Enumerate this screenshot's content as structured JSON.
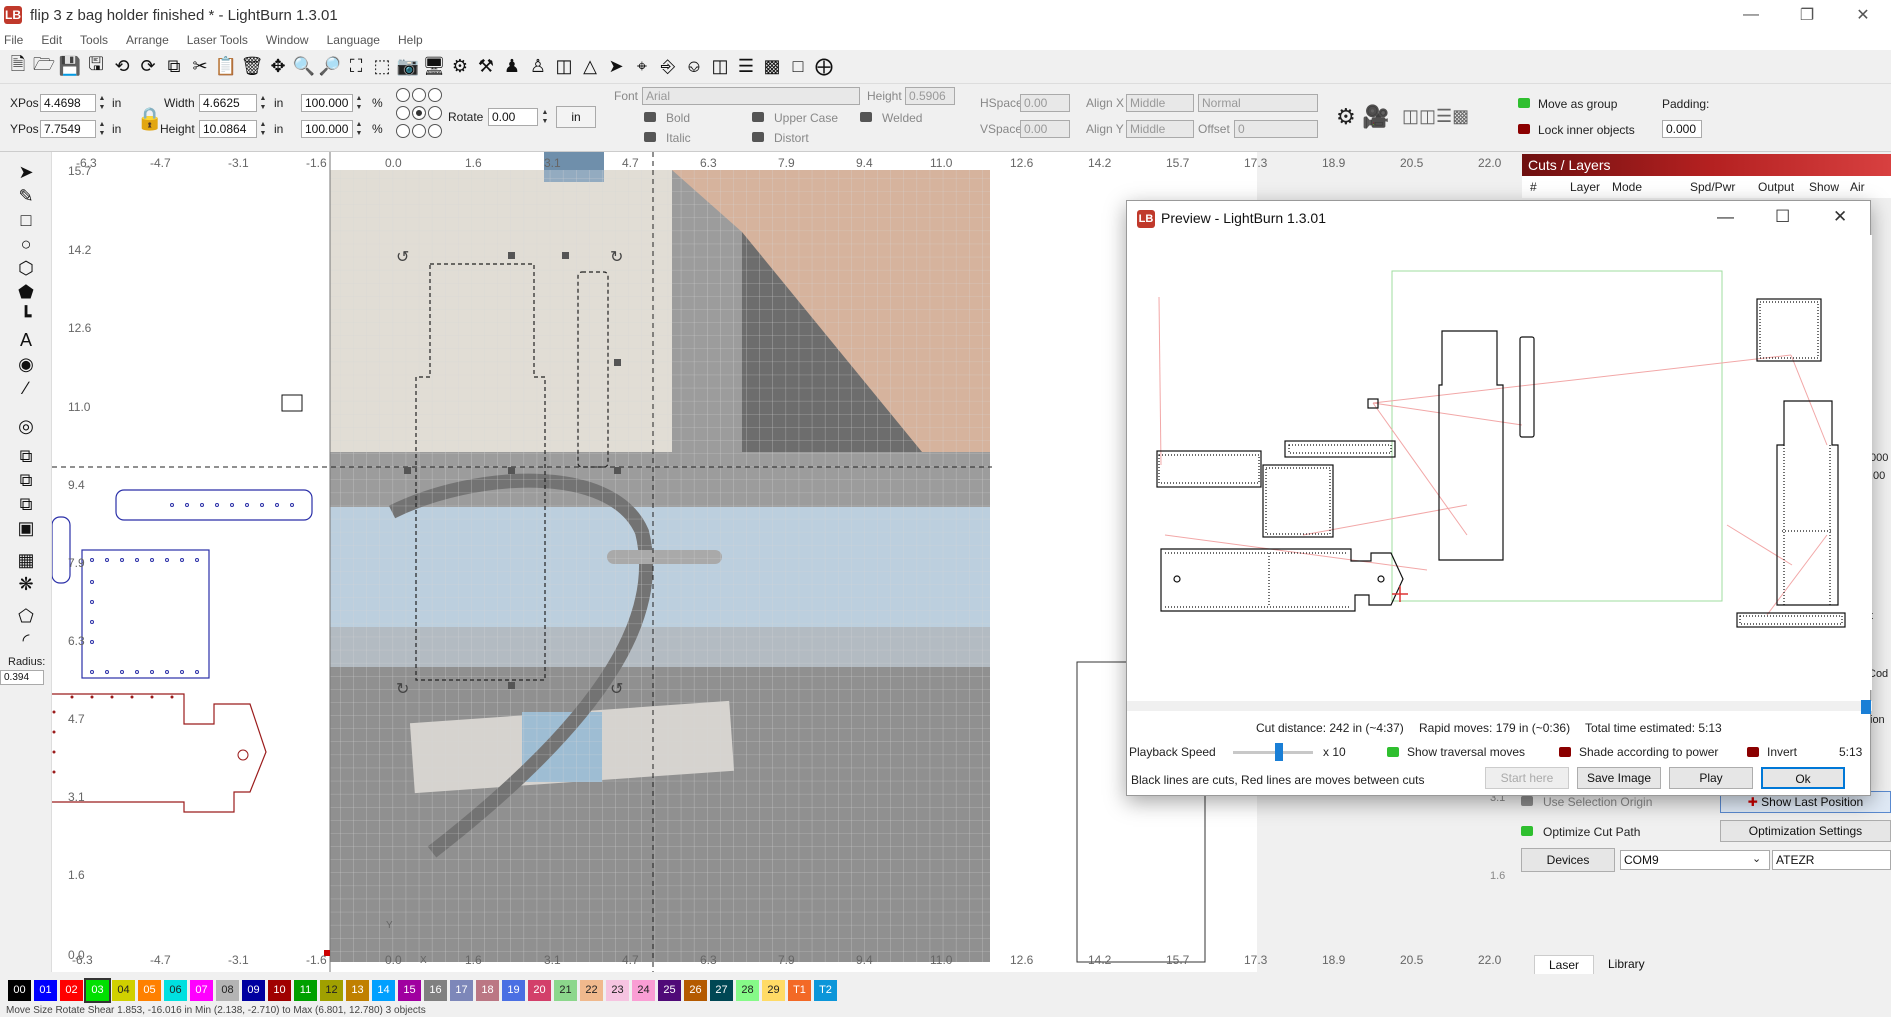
{
  "window": {
    "title": "flip 3 z bag holder finished * - LightBurn 1.3.01",
    "app_logo": "LB"
  },
  "menu": [
    "File",
    "Edit",
    "Tools",
    "Arrange",
    "Laser Tools",
    "Window",
    "Language",
    "Help"
  ],
  "props": {
    "xpos_label": "XPos",
    "xpos": "4.4698",
    "ypos_label": "YPos",
    "ypos": "7.7549",
    "unit": "in",
    "width_label": "Width",
    "width": "4.6625",
    "height_label": "Height",
    "height": "10.0864",
    "scale_w": "100.000",
    "scale_h": "100.000",
    "percent": "%",
    "rotate_label": "Rotate",
    "rotate": "0.00",
    "unit_btn": "in",
    "font_label": "Font",
    "font": "Arial",
    "fheight_label": "Height",
    "fheight": "0.5906",
    "hspace_label": "HSpace",
    "hspace": "0.00",
    "vspace_label": "VSpace",
    "vspace": "0.00",
    "alignx_label": "Align X",
    "alignx": "Middle",
    "aligny_label": "Align Y",
    "aligny": "Middle",
    "normal": "Normal",
    "offset_label": "Offset",
    "offset": "0",
    "bold": "Bold",
    "italic": "Italic",
    "upper": "Upper Case",
    "distort": "Distort",
    "welded": "Welded",
    "move_group": "Move as group",
    "lock_inner": "Lock inner objects",
    "padding_label": "Padding:",
    "padding": "0.000"
  },
  "left_tools": {
    "radius_label": "Radius:",
    "radius": "0.394"
  },
  "ruler": {
    "top": [
      "-6.3",
      "-4.7",
      "-3.1",
      "-1.6",
      "0.0",
      "1.6",
      "3.1",
      "4.7",
      "6.3",
      "7.9",
      "9.4",
      "11.0",
      "12.6",
      "14.2",
      "15.7",
      "17.3",
      "18.9",
      "20.5",
      "22.0"
    ],
    "left": [
      "15.7",
      "14.2",
      "12.6",
      "11.0",
      "9.4",
      "7.9",
      "6.3",
      "4.7",
      "3.1",
      "1.6",
      "0.0"
    ],
    "bottom": [
      "-6.3",
      "-4.7",
      "-3.1",
      "-1.6",
      "0.0",
      "1.6",
      "3.1",
      "4.7",
      "6.3",
      "7.9",
      "9.4",
      "11.0",
      "12.6",
      "14.2",
      "15.7",
      "17.3",
      "18.9",
      "20.5",
      "22.0"
    ],
    "y_axis": "Y",
    "x_axis": "X"
  },
  "cuts": {
    "header": "Cuts / Layers",
    "cols": [
      "#",
      "Layer",
      "Mode",
      "Spd/Pwr",
      "Output",
      "Show",
      "Air"
    ],
    "use_selection_origin": "Use Selection Origin",
    "show_last_position": "Show Last Position",
    "optimize_cut_path": "Optimize Cut Path",
    "optimization_settings": "Optimization Settings",
    "devices": "Devices",
    "port": "COM9",
    "device_name": "ATEZR",
    "tabs": [
      "Laser",
      "Library"
    ],
    "side_vals": [
      "000",
      ".00",
      "t",
      "Cod",
      "ion",
      "3.1",
      "1.6"
    ]
  },
  "preview": {
    "title": "Preview - LightBurn 1.3.01",
    "cut_distance": "Cut distance: 242 in (~4:37)",
    "rapid_moves": "Rapid moves: 179 in (~0:36)",
    "total_time": "Total time estimated: 5:13",
    "playback_label": "Playback Speed",
    "multiplier": "x 10",
    "show_traversal": "Show traversal moves",
    "shade_power": "Shade according to power",
    "invert": "Invert",
    "time_right": "5:13",
    "legend": "Black lines are cuts, Red lines are moves between cuts",
    "btn_start": "Start here",
    "btn_save": "Save Image",
    "btn_play": "Play",
    "btn_ok": "Ok"
  },
  "palette": [
    {
      "id": "00",
      "c": "#000000"
    },
    {
      "id": "01",
      "c": "#0000ff"
    },
    {
      "id": "02",
      "c": "#ff0000"
    },
    {
      "id": "03",
      "c": "#00e000"
    },
    {
      "id": "04",
      "c": "#d0d000"
    },
    {
      "id": "05",
      "c": "#ff8000"
    },
    {
      "id": "06",
      "c": "#00e0e0"
    },
    {
      "id": "07",
      "c": "#ff00ff"
    },
    {
      "id": "08",
      "c": "#b4b4b4"
    },
    {
      "id": "09",
      "c": "#0000a0"
    },
    {
      "id": "10",
      "c": "#a00000"
    },
    {
      "id": "11",
      "c": "#00a000"
    },
    {
      "id": "12",
      "c": "#a0a000"
    },
    {
      "id": "13",
      "c": "#c08000"
    },
    {
      "id": "14",
      "c": "#00a0ff"
    },
    {
      "id": "15",
      "c": "#a000a0"
    },
    {
      "id": "16",
      "c": "#808080"
    },
    {
      "id": "17",
      "c": "#7d87b9"
    },
    {
      "id": "18",
      "c": "#bb7784"
    },
    {
      "id": "19",
      "c": "#4a6fe3"
    },
    {
      "id": "20",
      "c": "#d33f6a"
    },
    {
      "id": "21",
      "c": "#8cd78c"
    },
    {
      "id": "22",
      "c": "#f0b98d"
    },
    {
      "id": "23",
      "c": "#f6c4e1"
    },
    {
      "id": "24",
      "c": "#fa9ed4"
    },
    {
      "id": "25",
      "c": "#500a78"
    },
    {
      "id": "26",
      "c": "#b45a00"
    },
    {
      "id": "27",
      "c": "#004754"
    },
    {
      "id": "28",
      "c": "#86fa88"
    },
    {
      "id": "29",
      "c": "#ffdb66"
    },
    {
      "id": "T1",
      "c": "#f36926"
    },
    {
      "id": "T2",
      "c": "#0c96d9"
    }
  ],
  "status": "Move  Size  Rotate  Shear  1.853, -16.016 in   Min (2.138, -2.710) to Max (6.801, 12.780) 3 objects"
}
